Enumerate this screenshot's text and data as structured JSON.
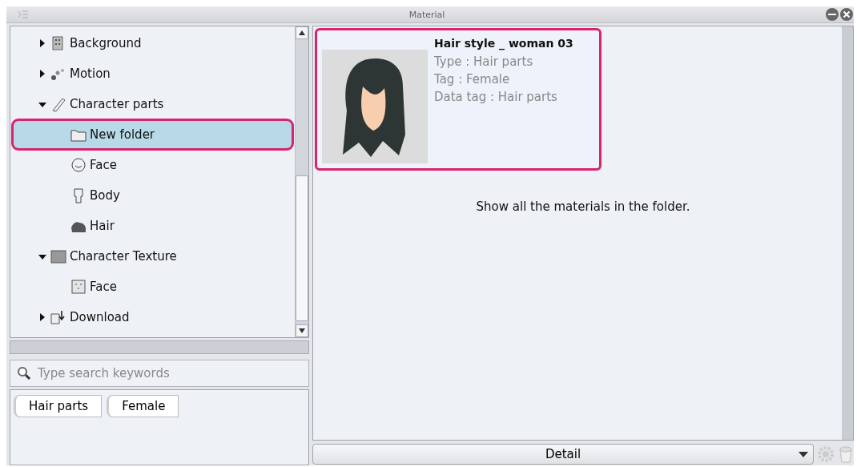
{
  "window": {
    "title": "Material"
  },
  "tree": {
    "items": [
      {
        "label": "Background",
        "expanded": false,
        "selected": false
      },
      {
        "label": "Motion",
        "expanded": false,
        "selected": false
      },
      {
        "label": "Character parts",
        "expanded": true,
        "selected": false,
        "children": [
          {
            "label": "New folder",
            "selected": true,
            "highlighted": true
          },
          {
            "label": "Face",
            "selected": false
          },
          {
            "label": "Body",
            "selected": false
          },
          {
            "label": "Hair",
            "selected": false
          }
        ]
      },
      {
        "label": "Character Texture",
        "expanded": true,
        "selected": false,
        "children": [
          {
            "label": "Face",
            "selected": false
          }
        ]
      },
      {
        "label": "Download",
        "expanded": false,
        "selected": false
      }
    ]
  },
  "search": {
    "placeholder": "Type search keywords"
  },
  "tags": [
    "Hair parts",
    "Female"
  ],
  "material": {
    "title": "Hair style _ woman 03",
    "details": [
      "Type : Hair parts",
      "Tag : Female",
      "Data tag : Hair parts"
    ],
    "highlighted": true
  },
  "message": "Show all the materials in the folder.",
  "view_select": {
    "value": "Detail"
  }
}
